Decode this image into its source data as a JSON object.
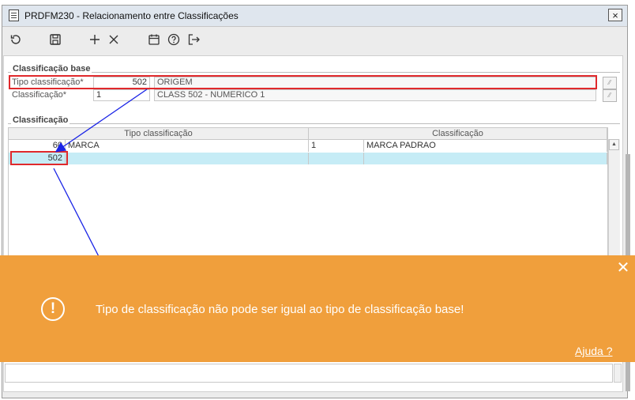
{
  "window": {
    "title": "PRDFM230 - Relacionamento entre Classificações",
    "close_label": "×"
  },
  "toolbar": {
    "icons": [
      "refresh-icon",
      "save-icon",
      "add-icon",
      "delete-icon",
      "calendar-icon",
      "help-icon",
      "exit-icon"
    ]
  },
  "base": {
    "group_label": "Classificação base",
    "tipo_label": "Tipo classificação*",
    "tipo_value": "502",
    "tipo_desc": "ORIGEM",
    "class_label": "Classificação*",
    "class_value": "1",
    "class_desc": "CLASS 502 - NUMERICO 1"
  },
  "grid": {
    "group_label": "Classificação",
    "columns": [
      "Tipo classificação",
      "Classificação"
    ],
    "rows": [
      {
        "tipo_code": "60",
        "tipo_desc": "MARCA",
        "class_code": "1",
        "class_desc": "MARCA PADRAO"
      },
      {
        "tipo_code": "502",
        "tipo_desc": "",
        "class_code": "",
        "class_desc": ""
      }
    ]
  },
  "toast": {
    "message": "Tipo de classificação não pode ser igual ao tipo de classificação base!",
    "help_link": "Ajuda ?",
    "close_label": "✕",
    "icon_text": "!",
    "color": "#f09f3c"
  },
  "annotations": {
    "highlight_color": "#e0292c",
    "arrow_color": "#1a24e6"
  }
}
